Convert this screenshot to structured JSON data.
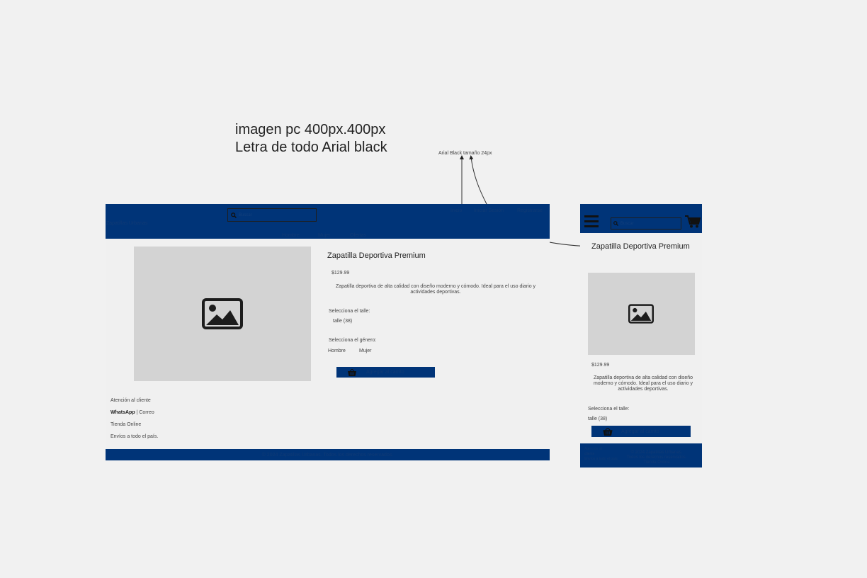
{
  "annotations": {
    "image_note_line1": "imagen pc 400px.400px",
    "image_note_line2": "Letra de todo Arial black",
    "font_note": "Arial Black tamaño 24px"
  },
  "desktop": {
    "brand": "Zapatillas Urbanas",
    "search_placeholder": "Buscar",
    "header_links": [
      "Inicio",
      "Iniciar Sesión",
      "Registrarse"
    ],
    "categories": [
      "Hombre",
      "Mujer",
      "Ofertas"
    ],
    "product": {
      "title": "Zapatilla Deportiva Premium",
      "price": "$129.99",
      "description_line1": "Zapatilla deportiva de alta calidad con diseño moderno y cómodo. Ideal para el uso diario y",
      "description_line2": "actividades deportivas.",
      "size_label": "Selecciona el talle:",
      "size_value": "talle (38)",
      "gender_label": "Selecciona el género:",
      "gender_options": [
        "Hombre",
        "Mujer"
      ],
      "add_to_cart": "Agregar al carrito"
    },
    "info": {
      "customer_service": "Atención al cliente",
      "whatsapp": "WhatsApp",
      "separator": " | ",
      "email": "Correo",
      "store": "Tienda Online",
      "shipping": "Envíos a todo el país."
    },
    "footer_text": "© 2024 Zapatillas Urbanas. Todos los derechos reservados."
  },
  "mobile": {
    "search_placeholder": "Buscar",
    "product": {
      "title": "Zapatilla Deportiva Premium",
      "price": "$129.99",
      "description_line1": "Zapatilla deportiva de alta calidad con diseño",
      "description_line2": "moderno y cómodo. Ideal para el uso diario y",
      "description_line3": "actividades deportivas.",
      "size_label": "Selecciona el talle:",
      "size_value": "talle (38)",
      "add_to_cart": "Agregar al carrito"
    },
    "footer": {
      "left_line1": "Atención al",
      "left_line2": "cliente",
      "left_line3": "Envíos a todo el país",
      "right_line1": "© 2024 Zapatillas Urbanas.",
      "right_line2": "Todos los derechos reservados.",
      "right_line3": "Tienda Online"
    }
  },
  "colors": {
    "header_blue": "#003478",
    "placeholder_gray": "#d3d3d3",
    "canvas": "#f1f1f1"
  },
  "icons": [
    "search-icon",
    "image-placeholder-icon",
    "basket-icon",
    "hamburger-menu-icon",
    "cart-icon"
  ]
}
